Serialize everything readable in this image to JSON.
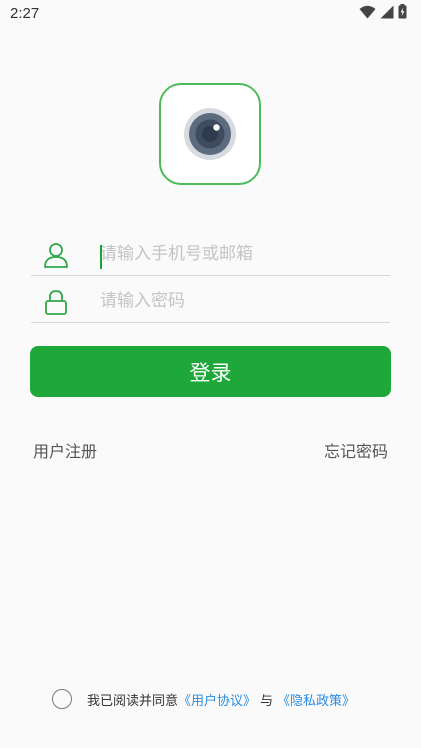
{
  "status_bar": {
    "time": "2:27"
  },
  "login_form": {
    "account_placeholder": "请输入手机号或邮箱",
    "password_placeholder": "请输入密码",
    "login_label": "登录"
  },
  "links": {
    "register": "用户注册",
    "forgot_password": "忘记密码"
  },
  "agreement": {
    "prefix": "我已阅读并同意",
    "user_agreement": "《用户协议》",
    "joiner": "与",
    "privacy_policy": "《隐私政策》"
  },
  "colors": {
    "primary_green": "#1fa83a",
    "logo_border": "#4cbb5a",
    "link_blue": "#2b8ce0"
  },
  "icons": {
    "account": "person-icon",
    "password": "lock-icon",
    "logo": "camera-lens-icon"
  }
}
